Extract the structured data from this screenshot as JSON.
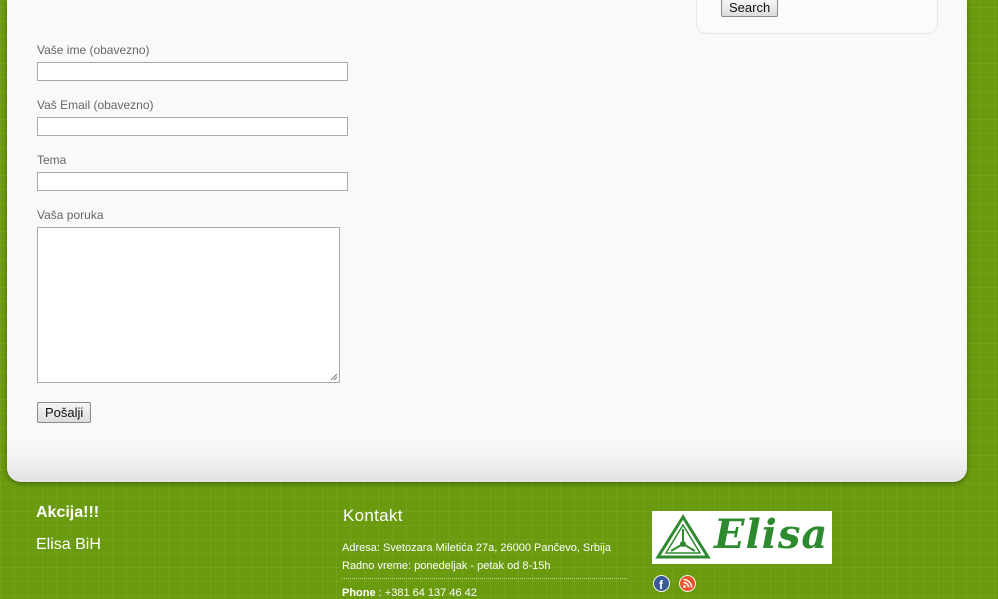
{
  "search": {
    "button_label": "Search"
  },
  "form": {
    "name_label": "Vaše ime (obavezno)",
    "email_label": "Vaš Email (obavezno)",
    "subject_label": "Tema",
    "message_label": "Vaša poruka",
    "name_value": "",
    "email_value": "",
    "subject_value": "",
    "message_value": "",
    "submit_label": "Pošalji"
  },
  "footer": {
    "links": [
      "Akcija!!!",
      "Elisa BiH"
    ],
    "contact": {
      "title": "Kontakt",
      "address": "Adresa: Svetozara Miletića 27a, 26000 Pančevo, Srbija",
      "hours": "Radno vreme: ponedeljak - petak od 8-15h",
      "phone_label": "Phone",
      "phone_value": " : +381 64 137 46 42"
    },
    "logo_text": "Elisa",
    "social_icons": [
      "facebook-icon",
      "rss-icon"
    ]
  },
  "colors": {
    "background": "#6a9a0e",
    "panel": "#f9f9f9",
    "logo_green": "#2e8a2e"
  }
}
